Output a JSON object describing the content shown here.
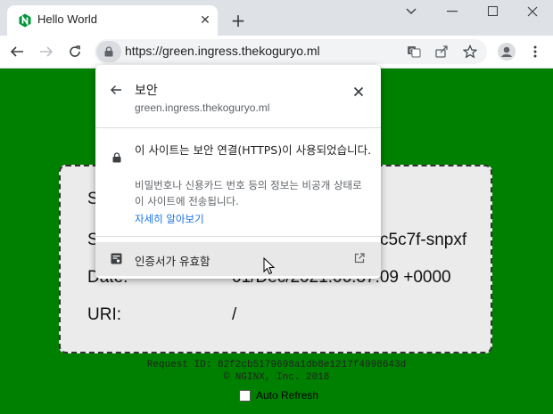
{
  "tab": {
    "title": "Hello World"
  },
  "address_bar": {
    "url": "https://green.ingress.thekoguryo.ml"
  },
  "page": {
    "server_address_label": "S",
    "server_name_label": "S",
    "server_name_value": "c5c7f-snpxf",
    "date_label": "Date:",
    "date_value": "01/Dec/2021:06:37:09 +0000",
    "uri_label": "URI:",
    "uri_value": "/",
    "request_id": "Request ID: 82f2cb5179698a1db8e1217f4998643d",
    "footer": "© NGINX, Inc. 2018",
    "auto_refresh": "Auto Refresh"
  },
  "security_popup": {
    "title": "보안",
    "host": "green.ingress.thekoguryo.ml",
    "message": "이 사이트는 보안 연결(HTTPS)이 사용되었습니다.",
    "sub_message": "비밀번호나 신용카드 번호 등의 정보는 비공개 상태로 이 사이트에 전송됩니다.",
    "learn_more": "자세히 알아보기",
    "certificate": "인증서가 유효함"
  },
  "colors": {
    "page_bg": "#008000",
    "link": "#1a73e8",
    "toolbar_bg": "#dee1e6"
  }
}
